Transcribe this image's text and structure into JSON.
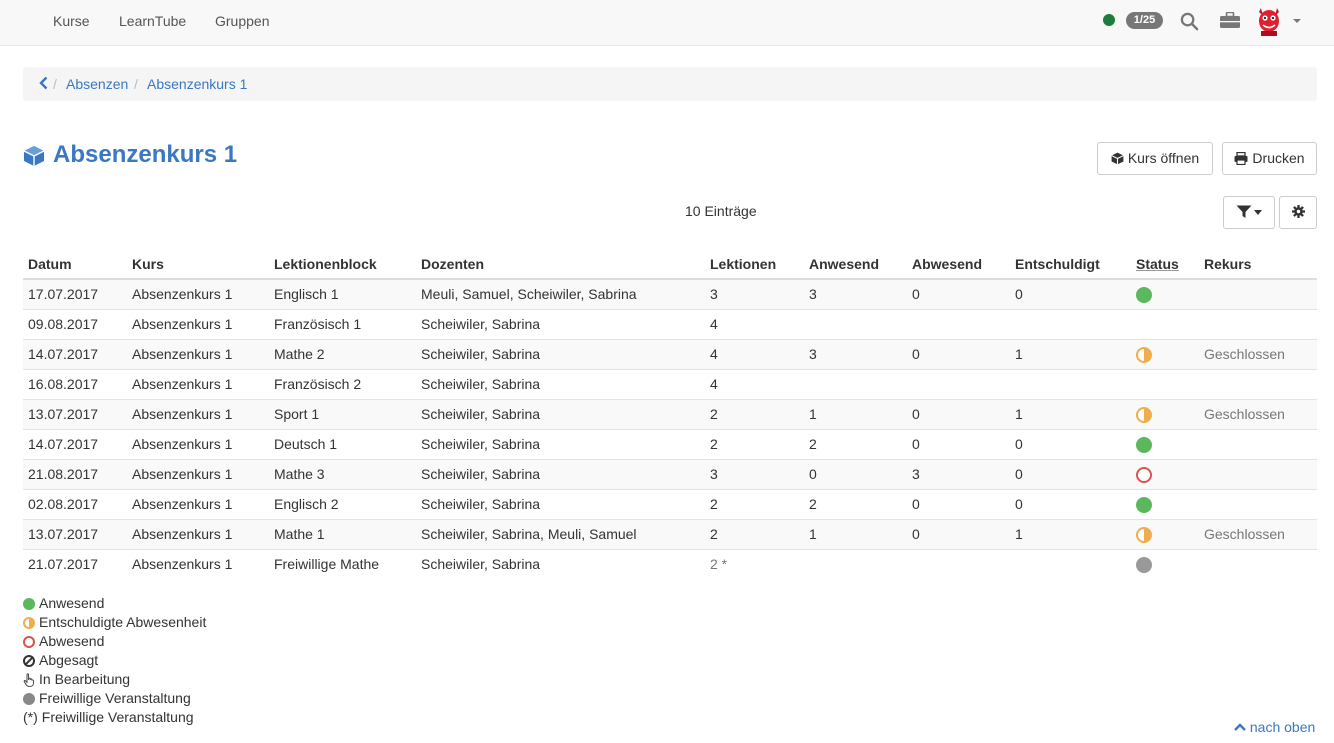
{
  "nav": {
    "items": [
      "Kurse",
      "LearnTube",
      "Gruppen"
    ],
    "badge": "1/25"
  },
  "breadcrumb": {
    "items": [
      "Absenzen",
      "Absenzenkurs 1"
    ]
  },
  "page": {
    "title": "Absenzenkurs 1",
    "open_course": "Kurs öffnen",
    "print": "Drucken",
    "entries": "10 Einträge"
  },
  "table": {
    "headers": [
      "Datum",
      "Kurs",
      "Lektionenblock",
      "Dozenten",
      "Lektionen",
      "Anwesend",
      "Abwesend",
      "Entschuldigt",
      "Status",
      "Rekurs"
    ],
    "rows": [
      {
        "datum": "17.07.2017",
        "kurs": "Absenzenkurs 1",
        "block": "Englisch 1",
        "dozenten": "Meuli, Samuel, Scheiwiler, Sabrina",
        "lektionen": "3",
        "anwesend": "3",
        "abwesend": "0",
        "entschuldigt": "0",
        "status": "green",
        "rekurs": ""
      },
      {
        "datum": "09.08.2017",
        "kurs": "Absenzenkurs 1",
        "block": "Französisch 1",
        "dozenten": "Scheiwiler, Sabrina",
        "lektionen": "4",
        "anwesend": "",
        "abwesend": "",
        "entschuldigt": "",
        "status": "",
        "rekurs": ""
      },
      {
        "datum": "14.07.2017",
        "kurs": "Absenzenkurs 1",
        "block": "Mathe 2",
        "dozenten": "Scheiwiler, Sabrina",
        "lektionen": "4",
        "anwesend": "3",
        "abwesend": "0",
        "entschuldigt": "1",
        "status": "half",
        "rekurs": "Geschlossen"
      },
      {
        "datum": "16.08.2017",
        "kurs": "Absenzenkurs 1",
        "block": "Französisch 2",
        "dozenten": "Scheiwiler, Sabrina",
        "lektionen": "4",
        "anwesend": "",
        "abwesend": "",
        "entschuldigt": "",
        "status": "",
        "rekurs": ""
      },
      {
        "datum": "13.07.2017",
        "kurs": "Absenzenkurs 1",
        "block": "Sport 1",
        "dozenten": "Scheiwiler, Sabrina",
        "lektionen": "2",
        "anwesend": "1",
        "abwesend": "0",
        "entschuldigt": "1",
        "status": "half",
        "rekurs": "Geschlossen"
      },
      {
        "datum": "14.07.2017",
        "kurs": "Absenzenkurs 1",
        "block": "Deutsch 1",
        "dozenten": "Scheiwiler, Sabrina",
        "lektionen": "2",
        "anwesend": "2",
        "abwesend": "0",
        "entschuldigt": "0",
        "status": "green",
        "rekurs": ""
      },
      {
        "datum": "21.08.2017",
        "kurs": "Absenzenkurs 1",
        "block": "Mathe 3",
        "dozenten": "Scheiwiler, Sabrina",
        "lektionen": "3",
        "anwesend": "0",
        "abwesend": "3",
        "entschuldigt": "0",
        "status": "red",
        "rekurs": ""
      },
      {
        "datum": "02.08.2017",
        "kurs": "Absenzenkurs 1",
        "block": "Englisch 2",
        "dozenten": "Scheiwiler, Sabrina",
        "lektionen": "2",
        "anwesend": "2",
        "abwesend": "0",
        "entschuldigt": "0",
        "status": "green",
        "rekurs": ""
      },
      {
        "datum": "13.07.2017",
        "kurs": "Absenzenkurs 1",
        "block": "Mathe 1",
        "dozenten": "Scheiwiler, Sabrina, Meuli, Samuel",
        "lektionen": "2",
        "anwesend": "1",
        "abwesend": "0",
        "entschuldigt": "1",
        "status": "half",
        "rekurs": "Geschlossen"
      },
      {
        "datum": "21.07.2017",
        "kurs": "Absenzenkurs 1",
        "block": "Freiwillige Mathe",
        "dozenten": "Scheiwiler, Sabrina",
        "lektionen": "2 *",
        "anwesend": "",
        "abwesend": "",
        "entschuldigt": "",
        "status": "grey",
        "rekurs": ""
      }
    ]
  },
  "legend": {
    "items": [
      {
        "icon": "green",
        "label": "Anwesend"
      },
      {
        "icon": "half",
        "label": "Entschuldigte Abwesenheit"
      },
      {
        "icon": "red",
        "label": "Abwesend"
      },
      {
        "icon": "ban",
        "label": "Abgesagt"
      },
      {
        "icon": "hand",
        "label": "In Bearbeitung"
      },
      {
        "icon": "grey",
        "label": "Freiwillige Veranstaltung"
      },
      {
        "icon": "text",
        "label": "Freiwillige Veranstaltung",
        "prefix": "(*)"
      }
    ]
  },
  "footer": {
    "back_to_top": "nach oben"
  },
  "colors": {
    "accent": "#3a78c3",
    "present": "#5cb85c",
    "excused": "#f0ad4e",
    "absent": "#d9534f",
    "voluntary": "#999999",
    "online": "#1b7e3c"
  }
}
